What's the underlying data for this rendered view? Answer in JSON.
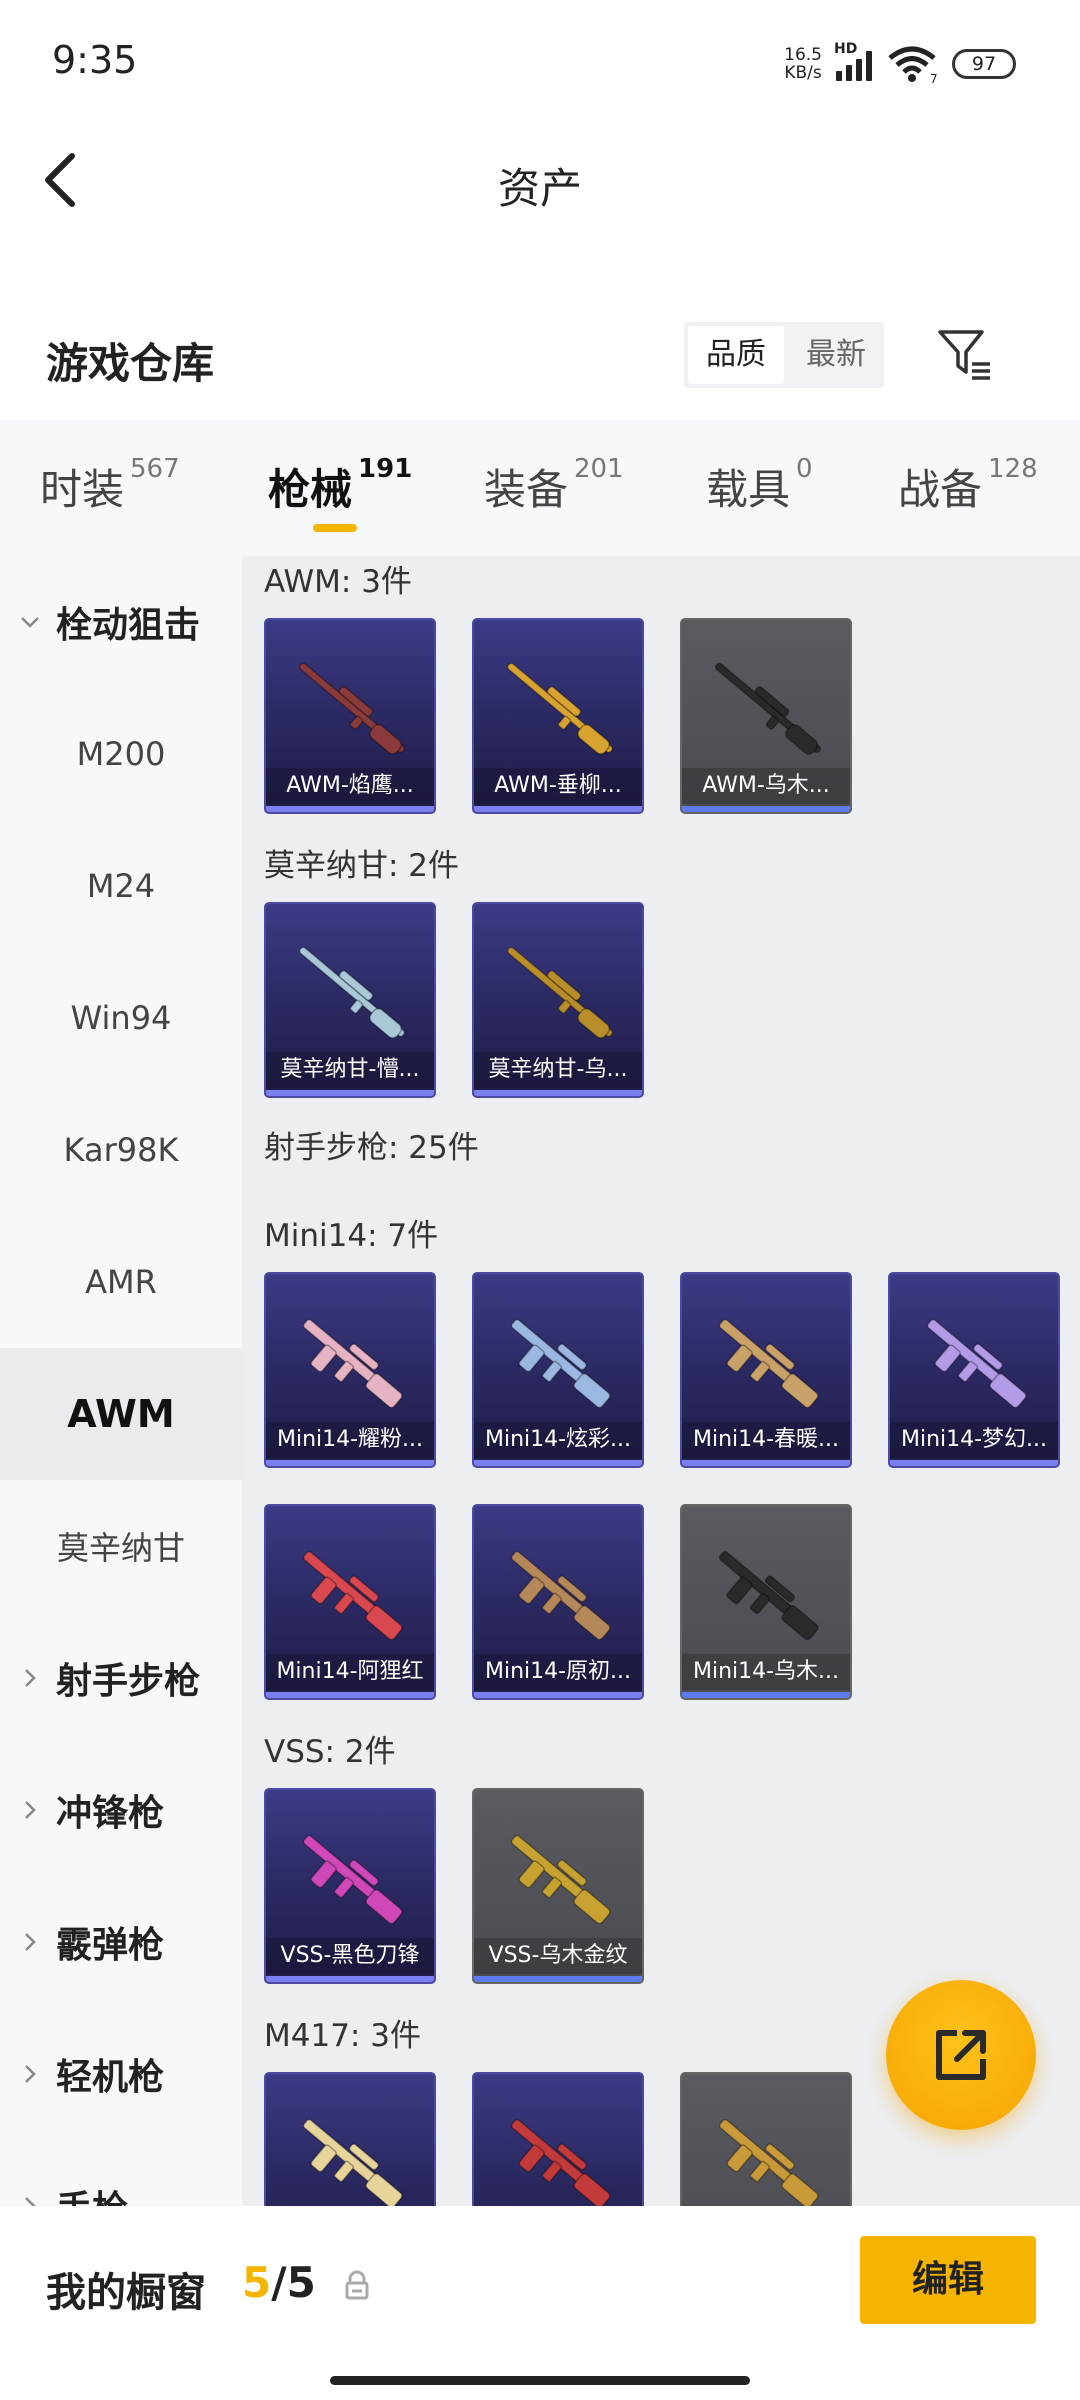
{
  "status_bar": {
    "time": "9:35",
    "net_speed_value": "16.5",
    "net_speed_unit": "KB/s",
    "network_type": "HD",
    "wifi_sub": "7",
    "battery": "97"
  },
  "header": {
    "title": "资产"
  },
  "warehouse": {
    "title": "游戏仓库",
    "sort_options": [
      "品质",
      "最新"
    ],
    "sort_active": "品质"
  },
  "tabs": [
    {
      "label": "时装",
      "count": "567"
    },
    {
      "label": "枪械",
      "count": "191"
    },
    {
      "label": "装备",
      "count": "201"
    },
    {
      "label": "载具",
      "count": "0"
    },
    {
      "label": "战备",
      "count": "128"
    }
  ],
  "active_tab": "枪械",
  "sidebar": [
    {
      "label": "栓动狙击",
      "type": "group-expanded"
    },
    {
      "label": "M200",
      "type": "item"
    },
    {
      "label": "M24",
      "type": "item"
    },
    {
      "label": "Win94",
      "type": "item"
    },
    {
      "label": "Kar98K",
      "type": "item"
    },
    {
      "label": "AMR",
      "type": "item"
    },
    {
      "label": "AWM",
      "type": "item-selected"
    },
    {
      "label": "莫辛纳甘",
      "type": "item"
    },
    {
      "label": "射手步枪",
      "type": "group"
    },
    {
      "label": "冲锋枪",
      "type": "group"
    },
    {
      "label": "霰弹枪",
      "type": "group"
    },
    {
      "label": "轻机枪",
      "type": "group"
    },
    {
      "label": "手枪",
      "type": "group"
    }
  ],
  "sections": [
    {
      "label": "AWM: 3件",
      "items": [
        {
          "name": "AWM-焰鹰...",
          "rarity": "purple",
          "weapon_color": "#8a3a3a"
        },
        {
          "name": "AWM-垂柳...",
          "rarity": "purple",
          "weapon_color": "#d8a331"
        },
        {
          "name": "AWM-乌木...",
          "rarity": "gray",
          "weapon_color": "#2a2a2a"
        }
      ]
    },
    {
      "label": "莫辛纳甘: 2件",
      "items": [
        {
          "name": "莫辛纳甘-懵...",
          "rarity": "purple",
          "weapon_color": "#a9c9d8"
        },
        {
          "name": "莫辛纳甘-乌...",
          "rarity": "purple",
          "weapon_color": "#b88d2a"
        }
      ]
    },
    {
      "label": "射手步枪: 25件",
      "items": []
    },
    {
      "label": "Mini14: 7件",
      "items": [
        {
          "name": "Mini14-耀粉...",
          "rarity": "purple",
          "weapon_color": "#e6b3c2"
        },
        {
          "name": "Mini14-炫彩...",
          "rarity": "purple",
          "weapon_color": "#9bb8e0"
        },
        {
          "name": "Mini14-春暖...",
          "rarity": "purple",
          "weapon_color": "#c9a26a"
        },
        {
          "name": "Mini14-梦幻...",
          "rarity": "purple",
          "weapon_color": "#b39be8"
        },
        {
          "name": "Mini14-阿狸红",
          "rarity": "purple",
          "weapon_color": "#d9474f"
        },
        {
          "name": "Mini14-原初...",
          "rarity": "purple",
          "weapon_color": "#b5885a"
        },
        {
          "name": "Mini14-乌木...",
          "rarity": "gray",
          "weapon_color": "#2a2a2a"
        }
      ]
    },
    {
      "label": "VSS: 2件",
      "items": [
        {
          "name": "VSS-黑色刀锋",
          "rarity": "purple",
          "weapon_color": "#d048b8"
        },
        {
          "name": "VSS-乌木金纹",
          "rarity": "gray",
          "weapon_color": "#c8a230"
        }
      ]
    },
    {
      "label": "M417: 3件",
      "items": [
        {
          "name": "",
          "rarity": "purple",
          "weapon_color": "#e6d49a"
        },
        {
          "name": "",
          "rarity": "purple",
          "weapon_color": "#c23a3a"
        },
        {
          "name": "",
          "rarity": "gray",
          "weapon_color": "#c89a3a"
        }
      ]
    }
  ],
  "bottom_bar": {
    "label": "我的橱窗",
    "current": "5",
    "separator": "/",
    "total": "5",
    "edit_label": "编辑"
  },
  "colors": {
    "accent": "#f5b400",
    "card_purple": "#3c3b87",
    "card_gray": "#55565b"
  }
}
